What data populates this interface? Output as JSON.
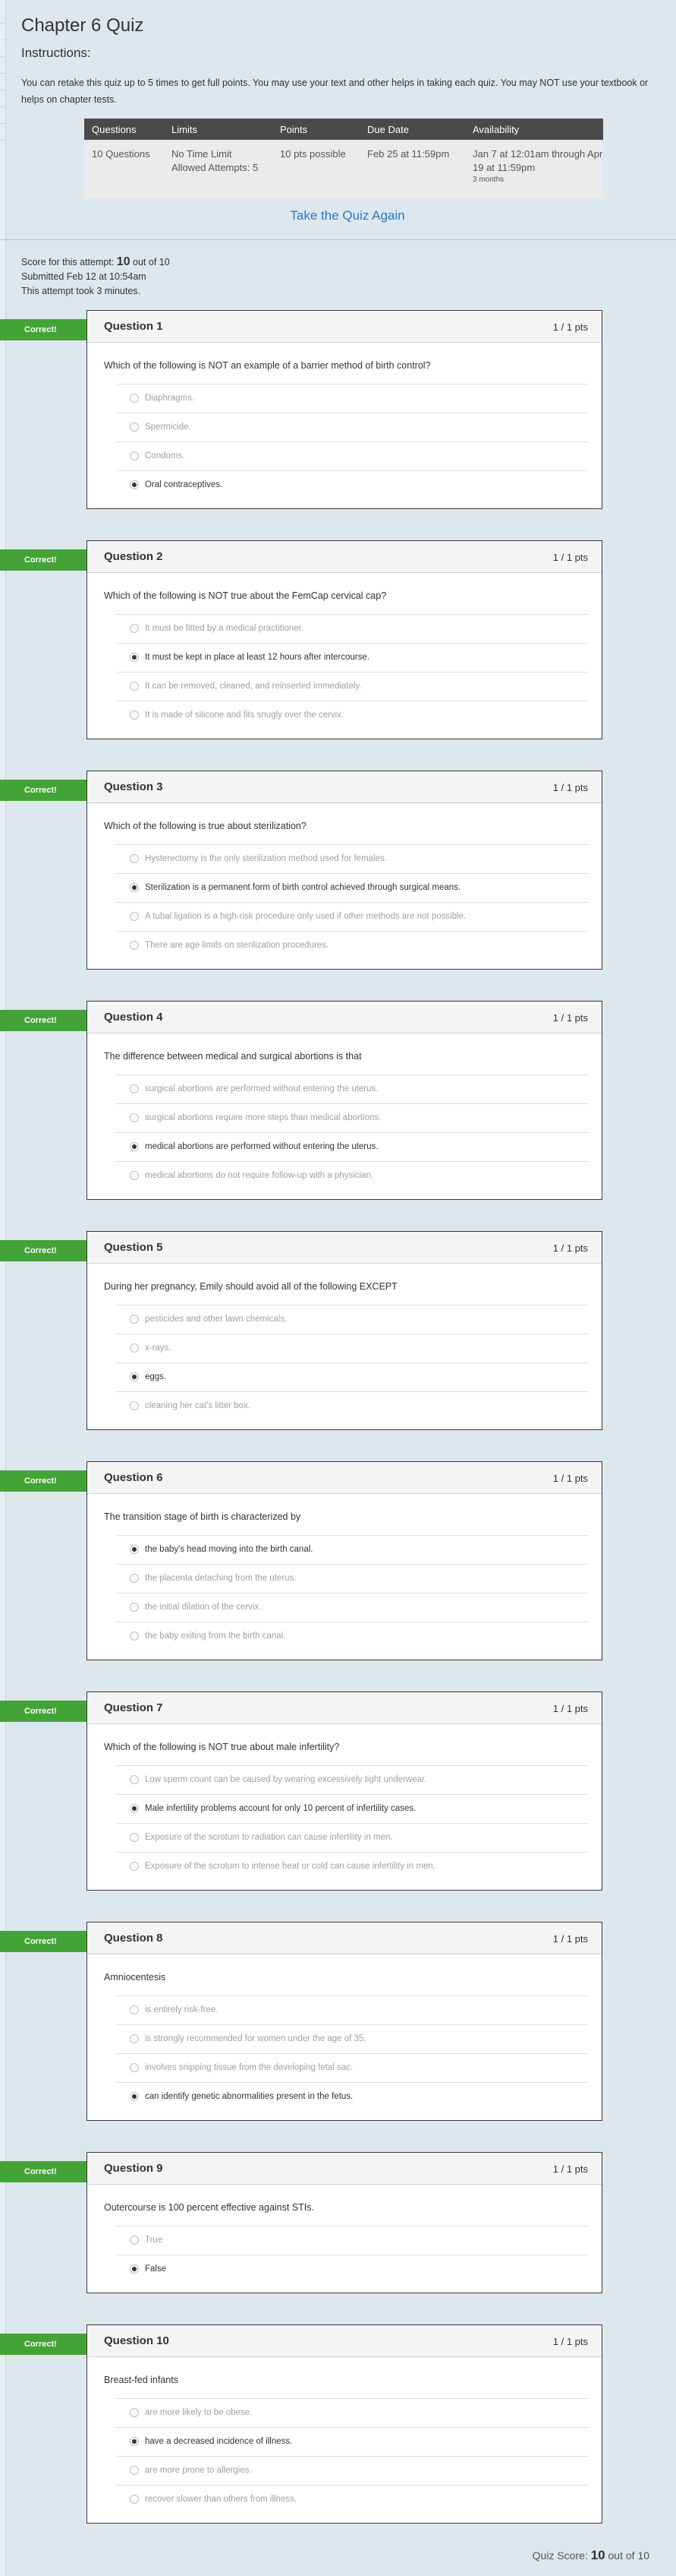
{
  "title": "Chapter 6 Quiz",
  "instructions": {
    "heading": "Instructions:",
    "text": "You can retake this quiz up to 5 times to get full points.  You may use your text and other helps in taking each quiz.  You may NOT use your textbook or helps on chapter tests."
  },
  "details": {
    "headers": [
      "Questions",
      "Limits",
      "Points",
      "Due Date",
      "Availability"
    ],
    "questions": "10 Questions",
    "limits_time": "No Time Limit",
    "limits_attempts": "Allowed Attempts: 5",
    "points": "10 pts possible",
    "due": "Feb 25 at 11:59pm",
    "availability": "Jan 7 at 12:01am through Apr 19 at 11:59pm",
    "availability_note": "3 months"
  },
  "take_again": "Take the Quiz Again",
  "attempt": {
    "score_prefix": "Score for this attempt: ",
    "score": "10",
    "score_suffix": " out of 10",
    "submitted": "Submitted Feb 12 at 10:54am",
    "duration": "This attempt took 3 minutes."
  },
  "badge_label": "Correct!",
  "questions": [
    {
      "name": "Question 1",
      "pts": "1 / 1 pts",
      "text": "Which of the following is NOT an example of a barrier method of birth control?",
      "answers": [
        "Diaphragms.",
        "Spermicide.",
        "Condoms.",
        "Oral contraceptives."
      ],
      "selected": 3
    },
    {
      "name": "Question 2",
      "pts": "1 / 1 pts",
      "text": "Which of the following is NOT true about the FemCap cervical cap?",
      "answers": [
        "It must be fitted by a medical practitioner.",
        "It must be kept in place at least 12 hours after intercourse.",
        "It can be removed, cleaned, and reinserted immediately.",
        "It is made of silicone and fits snugly over the cervix."
      ],
      "selected": 1
    },
    {
      "name": "Question 3",
      "pts": "1 / 1 pts",
      "text": "Which of the following is true about sterilization?",
      "answers": [
        "Hysterectomy is the only sterilization method used for females.",
        "Sterilization is a permanent form of birth control achieved through surgical means.",
        "A tubal ligation is a high-risk procedure only used if other methods are not possible.",
        "There are age limits on sterilization procedures."
      ],
      "selected": 1
    },
    {
      "name": "Question 4",
      "pts": "1 / 1 pts",
      "text": "The difference between medical and surgical abortions is that",
      "answers": [
        "surgical abortions are performed without entering the uterus.",
        "surgical abortions require more steps than medical abortions.",
        "medical abortions are performed without entering the uterus.",
        "medical abortions do not require follow-up with a physician."
      ],
      "selected": 2
    },
    {
      "name": "Question 5",
      "pts": "1 / 1 pts",
      "text": "During her pregnancy, Emily should avoid all of the following EXCEPT",
      "answers": [
        "pesticides and other lawn chemicals.",
        "x-rays.",
        "eggs.",
        "cleaning her cat's litter box."
      ],
      "selected": 2
    },
    {
      "name": "Question 6",
      "pts": "1 / 1 pts",
      "text": "The transition stage of birth is characterized by",
      "answers": [
        "the baby's head moving into the birth canal.",
        "the placenta detaching from the uterus.",
        "the initial dilation of the cervix.",
        "the baby exiting from the birth canal."
      ],
      "selected": 0
    },
    {
      "name": "Question 7",
      "pts": "1 / 1 pts",
      "text": "Which of the following is NOT true about male infertility?",
      "answers": [
        "Low sperm count can be caused by wearing excessively tight underwear.",
        "Male infertility problems account for only 10 percent of infertility cases.",
        "Exposure of the scrotum to radiation can cause infertility in men.",
        "Exposure of the scrotum to intense heat or cold can cause infertility in men."
      ],
      "selected": 1
    },
    {
      "name": "Question 8",
      "pts": "1 / 1 pts",
      "text": "Amniocentesis",
      "answers": [
        "is entirely risk-free.",
        "is strongly recommended for women under the age of 35.",
        "involves snipping tissue from the developing fetal sac.",
        "can identify genetic abnormalities present in the fetus."
      ],
      "selected": 3
    },
    {
      "name": "Question 9",
      "pts": "1 / 1 pts",
      "text": "Outercourse is 100 percent effective against STIs.",
      "answers": [
        "True",
        "False"
      ],
      "selected": 1
    },
    {
      "name": "Question 10",
      "pts": "1 / 1 pts",
      "text": "Breast-fed infants",
      "answers": [
        "are more likely to be obese.",
        "have a decreased incidence of illness.",
        "are more prone to allergies.",
        "recover slower than others from illness."
      ],
      "selected": 1
    }
  ],
  "final": {
    "prefix": "Quiz Score: ",
    "score": "10",
    "suffix": " out of 10"
  }
}
